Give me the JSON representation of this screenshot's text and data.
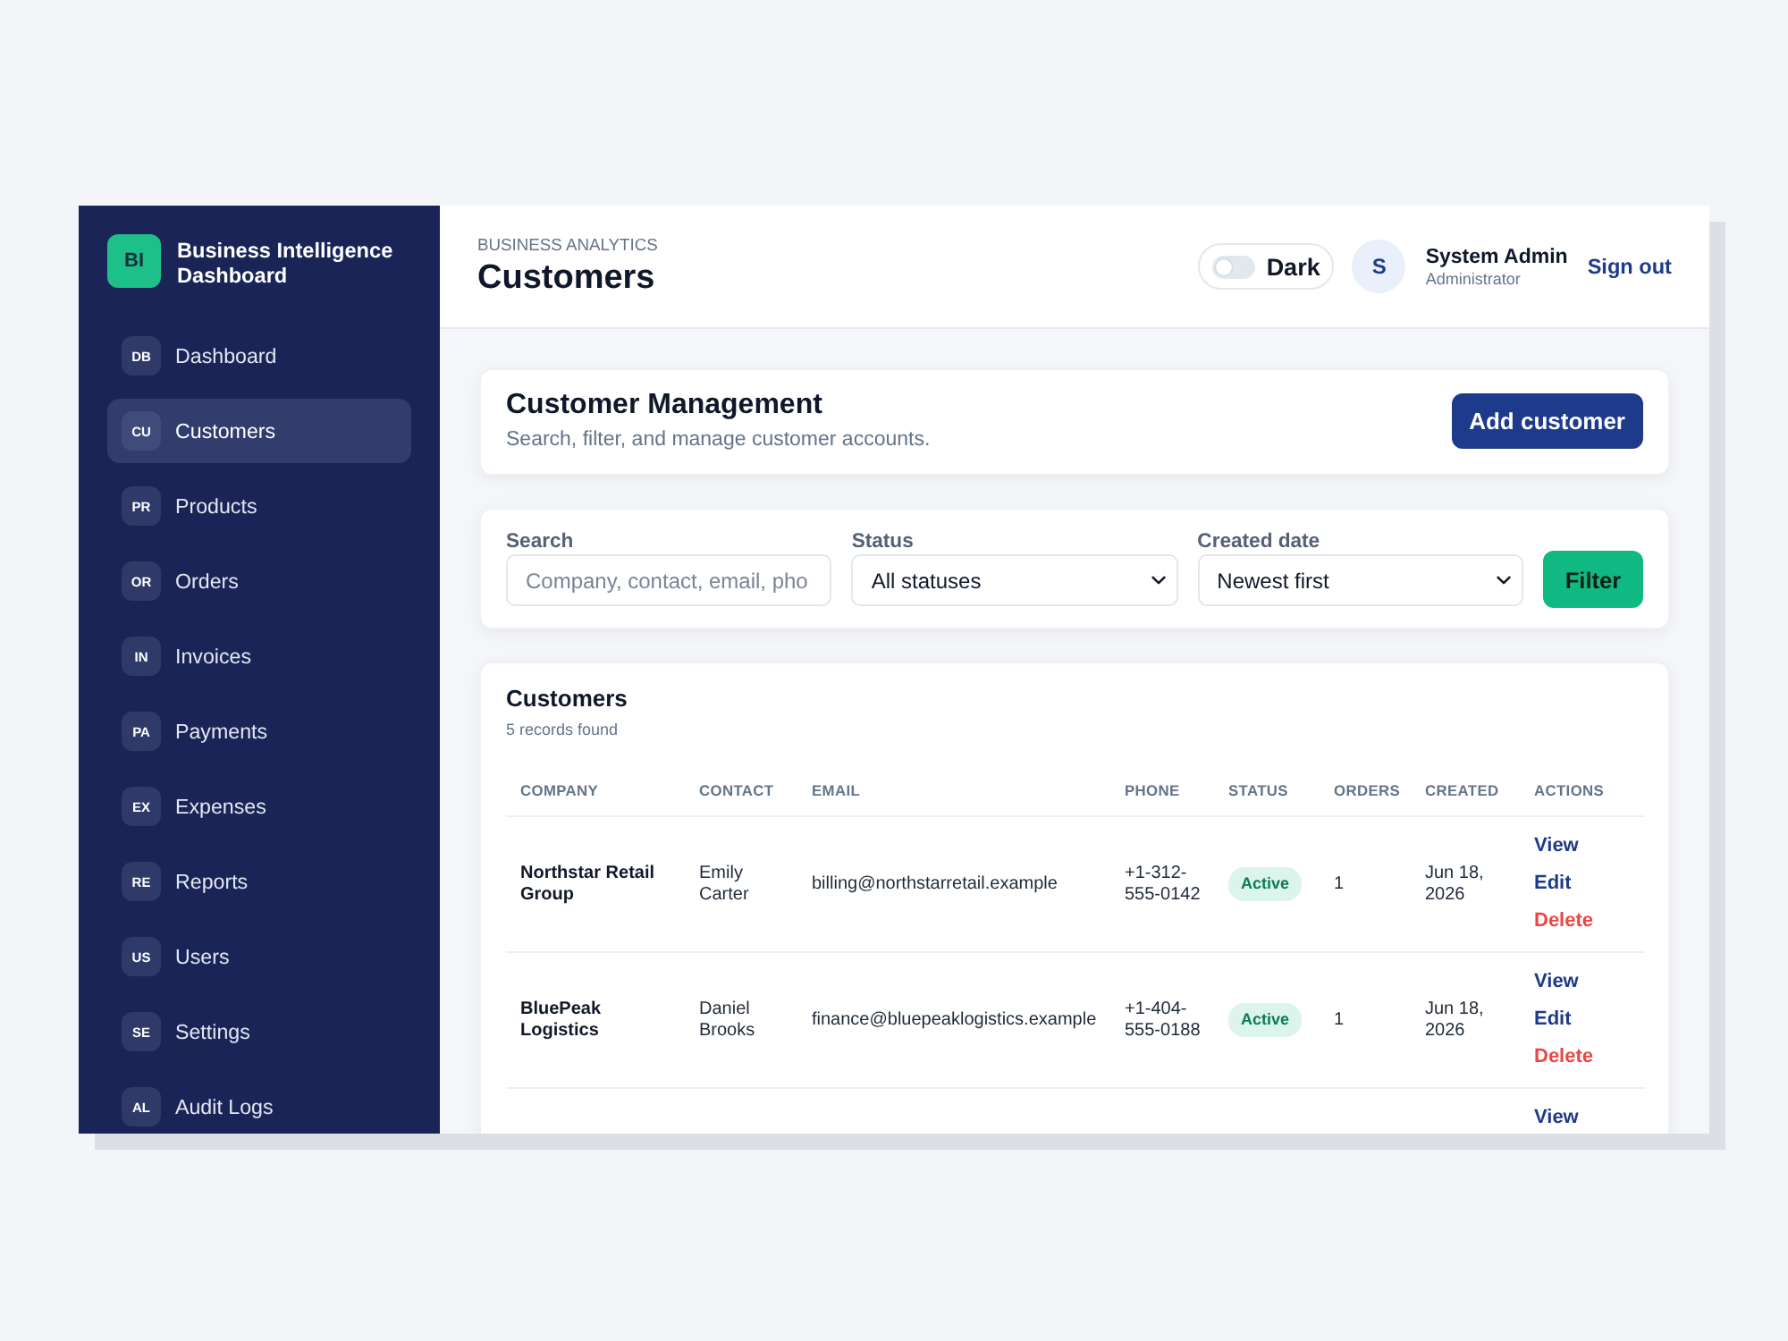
{
  "sidebar": {
    "logo": "BI",
    "title": "Business Intelligence Dashboard",
    "items": [
      {
        "abbr": "DB",
        "label": "Dashboard",
        "selected": false
      },
      {
        "abbr": "CU",
        "label": "Customers",
        "selected": true
      },
      {
        "abbr": "PR",
        "label": "Products",
        "selected": false
      },
      {
        "abbr": "OR",
        "label": "Orders",
        "selected": false
      },
      {
        "abbr": "IN",
        "label": "Invoices",
        "selected": false
      },
      {
        "abbr": "PA",
        "label": "Payments",
        "selected": false
      },
      {
        "abbr": "EX",
        "label": "Expenses",
        "selected": false
      },
      {
        "abbr": "RE",
        "label": "Reports",
        "selected": false
      },
      {
        "abbr": "US",
        "label": "Users",
        "selected": false
      },
      {
        "abbr": "SE",
        "label": "Settings",
        "selected": false
      },
      {
        "abbr": "AL",
        "label": "Audit Logs",
        "selected": false
      }
    ]
  },
  "header": {
    "eyebrow": "BUSINESS ANALYTICS",
    "title": "Customers",
    "theme_toggle": {
      "label": "Dark",
      "on": false
    },
    "user": {
      "initial": "S",
      "name": "System Admin",
      "role": "Administrator"
    },
    "sign_out": "Sign out"
  },
  "intro_card": {
    "title": "Customer Management",
    "subtitle": "Search, filter, and manage customer accounts.",
    "button": "Add customer"
  },
  "filters": {
    "fields": [
      {
        "kind": "text",
        "label": "Search",
        "placeholder": "Company, contact, email, pho"
      },
      {
        "kind": "select",
        "label": "Status",
        "value": "All statuses"
      },
      {
        "kind": "select",
        "label": "Created date",
        "value": "Newest first"
      }
    ],
    "button": "Filter"
  },
  "table": {
    "title": "Customers",
    "count": "5 records found",
    "columns": [
      "COMPANY",
      "CONTACT",
      "EMAIL",
      "PHONE",
      "STATUS",
      "ORDERS",
      "CREATED",
      "ACTIONS"
    ],
    "rows": [
      {
        "company": "Northstar Retail Group",
        "contact": "Emily Carter",
        "email": "billing@northstarretail.example",
        "phone": "+1-312-555-0142",
        "status": {
          "label": "Active",
          "kind": "active"
        },
        "orders": "1",
        "created": "Jun 18, 2026",
        "actions": [
          {
            "label": "View",
            "kind": "view"
          },
          {
            "label": "Edit",
            "kind": "edit"
          },
          {
            "label": "Delete",
            "kind": "delete"
          }
        ]
      },
      {
        "company": "BluePeak Logistics",
        "contact": "Daniel Brooks",
        "email": "finance@bluepeaklogistics.example",
        "phone": "+1-404-555-0188",
        "status": {
          "label": "Active",
          "kind": "active"
        },
        "orders": "1",
        "created": "Jun 18, 2026",
        "actions": [
          {
            "label": "View",
            "kind": "view"
          },
          {
            "label": "Edit",
            "kind": "edit"
          },
          {
            "label": "Delete",
            "kind": "delete"
          }
        ]
      },
      {
        "actions": [
          {
            "label": "View",
            "kind": "view"
          }
        ]
      }
    ]
  }
}
